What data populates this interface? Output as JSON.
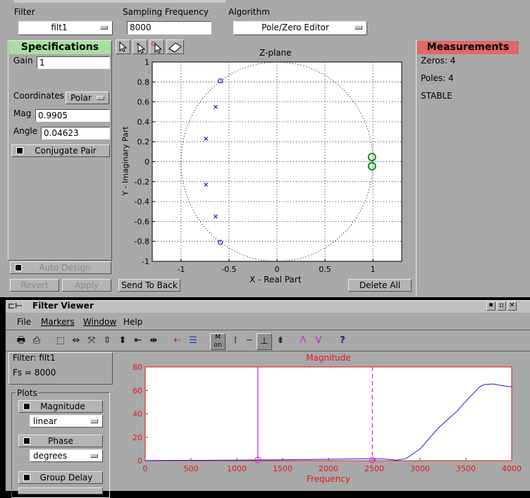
{
  "top": {
    "filter_label": "Filter",
    "filter_value": "filt1",
    "sampling_label": "Sampling Frequency",
    "sampling_value": "8000",
    "algorithm_label": "Algorithm",
    "algorithm_value": "Pole/Zero Editor"
  },
  "specs": {
    "header": "Specifications",
    "gain_label": "Gain",
    "gain_value": "1",
    "coordinates_label": "Coordinates",
    "coordinates_value": "Polar",
    "mag_label": "Mag",
    "mag_value": "0.9905",
    "angle_label": "Angle",
    "angle_value": "0.04623",
    "conjugate_label": "Conjugate Pair",
    "auto_design_label": "Auto Design",
    "revert_label": "Revert",
    "apply_label": "Apply"
  },
  "zplane": {
    "title": "Z-plane",
    "xlabel": "X - Real Part",
    "ylabel": "Y - Imaginary Part",
    "xticks": [
      "-1",
      "-0.5",
      "0",
      "0.5",
      "1"
    ],
    "yticks": [
      "1",
      "0.8",
      "0.6",
      "0.4",
      "0.2",
      "0",
      "-0.2",
      "-0.4",
      "-0.6",
      "-0.8",
      "-1"
    ],
    "send_to_back_label": "Send To Back",
    "delete_all_label": "Delete All"
  },
  "measurements": {
    "header": "Measurements",
    "zeros": "Zeros:  4",
    "poles": "Poles:  4",
    "status": "STABLE"
  },
  "viewer": {
    "title": "Filter Viewer",
    "menu": [
      "File",
      "Markers",
      "Window",
      "Help"
    ],
    "filter_info": "Filter: filt1",
    "fs_info": "Fs = 8000",
    "plots_label": "Plots",
    "magnitude_label": "Magnitude",
    "magnitude_scale": "linear",
    "phase_label": "Phase",
    "phase_units": "degrees",
    "group_delay_label": "Group Delay"
  },
  "colors": {
    "panel": "#a9a9a9",
    "spec_header": "#a8e0a0",
    "meas_header": "#e06868",
    "plot_axes": "#e01818",
    "pole_zero": "#2020d0",
    "selected_zero": "#109010",
    "marker": "#d020d0"
  },
  "chart_data": [
    {
      "type": "scatter",
      "title": "Z-plane",
      "xlabel": "X - Real Part",
      "ylabel": "Y - Imaginary Part",
      "xlim": [
        -1.3,
        1.3
      ],
      "ylim": [
        -1,
        1
      ],
      "grid": true,
      "unit_circle": true,
      "zeros": [
        {
          "x": -0.59,
          "y": 0.81
        },
        {
          "x": -0.59,
          "y": -0.81
        },
        {
          "x": 0.99,
          "y": 0.046,
          "selected": true
        },
        {
          "x": 0.99,
          "y": -0.046,
          "selected": true
        }
      ],
      "poles": [
        {
          "x": -0.64,
          "y": 0.55
        },
        {
          "x": -0.74,
          "y": 0.23
        },
        {
          "x": -0.74,
          "y": -0.23
        },
        {
          "x": -0.64,
          "y": -0.55
        }
      ]
    },
    {
      "type": "line",
      "title": "Magnitude",
      "xlabel": "Frequency",
      "ylabel": "",
      "xlim": [
        0,
        4000
      ],
      "ylim": [
        0,
        80
      ],
      "xticks": [
        "0",
        "500",
        "1000",
        "1500",
        "2000",
        "2500",
        "3000",
        "3500",
        "4000"
      ],
      "yticks": [
        "80",
        "60",
        "40",
        "20",
        "0"
      ],
      "grid": false,
      "series": [
        {
          "x": [
            0,
            500,
            1000,
            1500,
            2000,
            2400,
            2600,
            2750,
            2850,
            3000,
            3200,
            3400,
            3550,
            3650,
            3700,
            3800,
            3900,
            4000
          ],
          "values": [
            0.2,
            0.3,
            0.5,
            0.8,
            1.2,
            1.6,
            1.5,
            0.5,
            2,
            10,
            28,
            42,
            55,
            63,
            65,
            65.5,
            64,
            63
          ]
        }
      ],
      "markers": [
        {
          "x": 1230,
          "style": "solid"
        },
        {
          "x": 2480,
          "style": "dashed"
        }
      ]
    }
  ]
}
